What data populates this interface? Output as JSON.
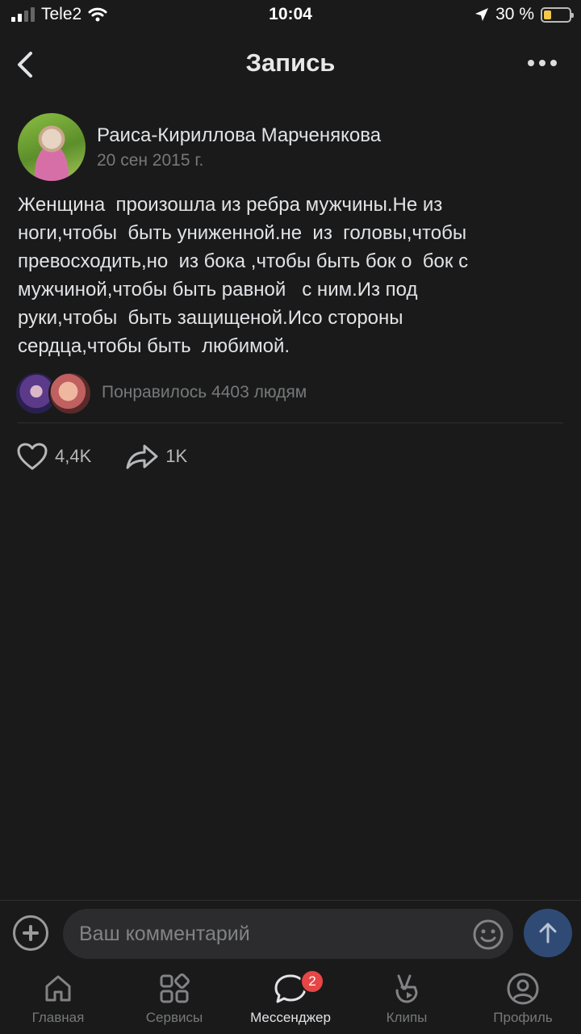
{
  "status_bar": {
    "carrier": "Tele2",
    "time": "10:04",
    "battery": "30 %"
  },
  "header": {
    "title": "Запись"
  },
  "post": {
    "author": "Раиса-Кириллова Марченякова",
    "date": "20 сен 2015 г.",
    "text": "Женщина  произошла из ребра мужчины.Не из\nноги,чтобы  быть униженной.не  из  головы,чтобы\nпревосходить,но  из бока ,чтобы быть бок о  бок с\nмужчиной,чтобы быть равной   с ним.Из под\nруки,чтобы  быть защищеной.Исо стороны\nсердца,чтобы быть  любимой.",
    "liked_by_text": "Понравилось 4403 людям",
    "likes_count": "4,4K",
    "shares_count": "1K"
  },
  "comment": {
    "placeholder": "Ваш комментарий"
  },
  "tabs": [
    {
      "label": "Главная",
      "icon": "home-icon"
    },
    {
      "label": "Сервисы",
      "icon": "services-icon"
    },
    {
      "label": "Мессенджер",
      "icon": "messenger-icon",
      "badge": "2",
      "active": true
    },
    {
      "label": "Клипы",
      "icon": "clips-icon"
    },
    {
      "label": "Профиль",
      "icon": "profile-icon"
    }
  ],
  "colors": {
    "background": "#1a1a1a",
    "accent_send": "#2f4b75",
    "badge": "#e64646"
  }
}
